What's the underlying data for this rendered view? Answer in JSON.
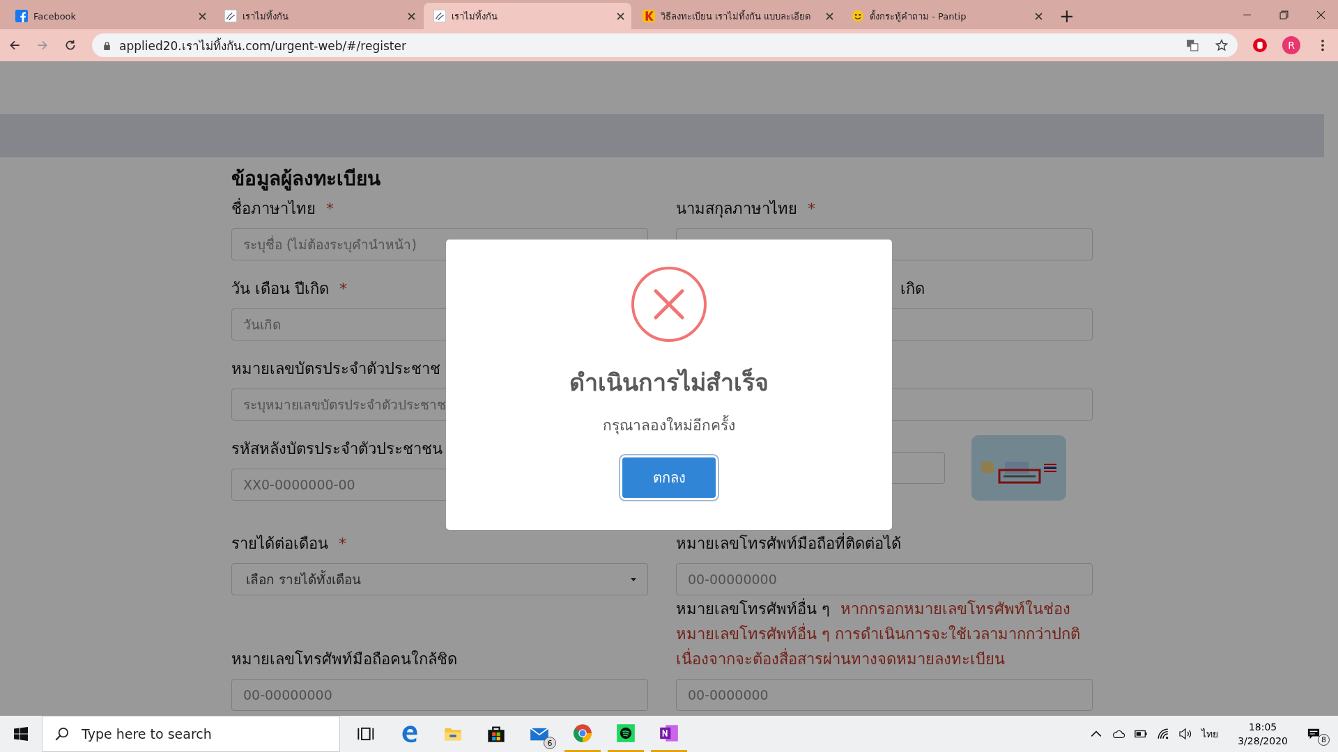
{
  "browser": {
    "tabs": [
      {
        "title": "Facebook",
        "kind": "facebook",
        "selected": false
      },
      {
        "title": "เราไม่ทิ้งกัน",
        "kind": "site",
        "selected": false
      },
      {
        "title": "เราไม่ทิ้งกัน",
        "kind": "site",
        "selected": true
      },
      {
        "title": "วิธีลงทะเบียน เราไม่ทิ้งกัน แบบละเอียด",
        "kind": "k",
        "selected": false
      },
      {
        "title": "ตั้งกระทู้คำถาม - Pantip",
        "kind": "smiley",
        "selected": false
      }
    ],
    "new_tab": "+",
    "url": "applied20.เราไม่ทิ้งกัน.com/urgent-web/#/register",
    "profile": "R"
  },
  "form": {
    "heading": "ข้อมูลผู้ลงทะเบียน",
    "rows": [
      {
        "left": {
          "label": "ชื่อภาษาไทย",
          "required_mark": "*",
          "kind": "text",
          "placeholder": "ระบุชื่อ (ไม่ต้องระบุคำนำหน้า)"
        },
        "right": {
          "label": "นามสกุลภาษาไทย",
          "required_mark": "*",
          "kind": "text"
        }
      },
      {
        "left": {
          "label": "วัน เดือน ปีเกิด",
          "required_mark": "*",
          "kind": "text",
          "placeholder": "วันเกิด"
        },
        "right": {
          "label": "เกิด",
          "kind": "text"
        }
      },
      {
        "left": {
          "label": "หมายเลขบัตรประจำตัวประชาช",
          "kind": "text",
          "placeholder": "ระบุหมายเลขบัตรประจำตัวประชาช"
        },
        "right": {
          "kind": "text"
        }
      },
      {
        "left": {
          "label": "รหัสหลังบัตรประจำตัวประชาชน",
          "kind": "text",
          "placeholder": "XX0-0000000-00"
        },
        "right": {
          "kind": "card"
        }
      },
      {
        "left": {
          "label": "รายได้ต่อเดือน",
          "required_mark": "*",
          "kind": "select",
          "value": "เลือก รายได้ทั้งเดือน"
        },
        "right": {
          "label": "หมายเลขโทรศัพท์มือถือที่ติดต่อได้",
          "kind": "text",
          "placeholder": "00-00000000"
        }
      },
      {
        "left": {
          "label": "หมายเลขโทรศัพท์มือถือคนใกล้ชิด",
          "kind": "text",
          "placeholder": "00-00000000"
        },
        "right": {
          "label": "หมายเลขโทรศัพท์อื่น ๆ",
          "note": "หากกรอกหมายเลขโทรศัพท์ในช่องหมายเลขโทรศัพท์อื่น ๆ การดำเนินการจะใช้เวลามากกว่าปกติ เนื่องจากจะต้องสื่อสารผ่านทางจดหมายลงทะเบียน",
          "kind": "text",
          "placeholder": "00-0000000"
        }
      }
    ]
  },
  "dialog": {
    "title": "ดำเนินการไม่สำเร็จ",
    "message": "กรุณาลองใหม่อีกครั้ง",
    "button": "ตกลง"
  },
  "taskbar": {
    "search_placeholder": "Type here to search",
    "apps": [
      {
        "kind": "taskview",
        "active": false
      },
      {
        "kind": "edge",
        "active": false
      },
      {
        "kind": "explorer",
        "active": false
      },
      {
        "kind": "store",
        "active": false
      },
      {
        "kind": "mail",
        "active": false,
        "badge": "6"
      },
      {
        "kind": "chrome",
        "active": true
      },
      {
        "kind": "spotify",
        "active": true
      },
      {
        "kind": "onenote",
        "active": true
      }
    ],
    "language": "ไทย",
    "time": "18:05",
    "date": "3/28/2020",
    "notifications": "8"
  }
}
